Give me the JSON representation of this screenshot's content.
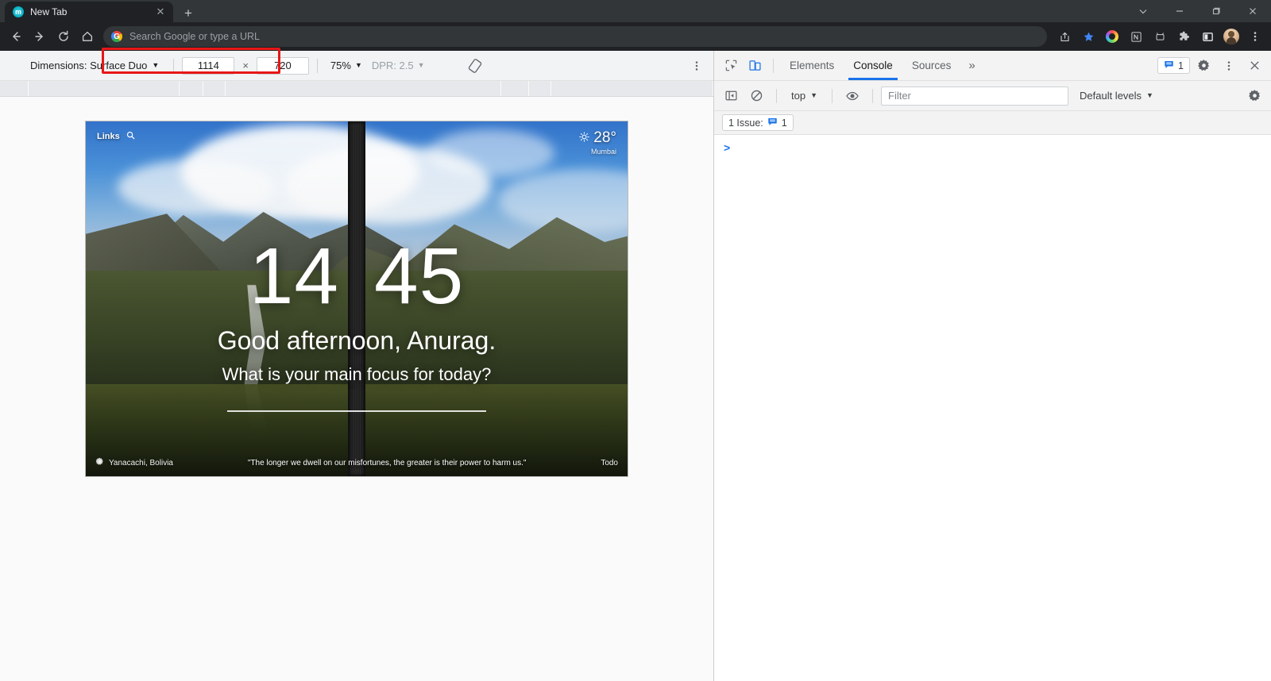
{
  "browser": {
    "tab": {
      "title": "New Tab",
      "favicon_icon": "circle-m-icon",
      "close_icon": "close-icon"
    },
    "new_tab_button_label": "+",
    "nav": {
      "back_icon": "back-arrow-icon",
      "forward_icon": "forward-arrow-icon",
      "reload_icon": "reload-icon",
      "home_icon": "home-icon"
    },
    "omnibox": {
      "placeholder": "Search Google or type a URL",
      "value": "",
      "search_engine_icon": "google-g-icon"
    },
    "toolbar_icons": [
      "share-icon",
      "bookmark-star-icon",
      "extension-color-icon",
      "notion-icon",
      "extension-small-icon",
      "puzzle-extensions-icon",
      "side-panel-icon",
      "profile-avatar-icon",
      "chrome-menu-icon"
    ],
    "window_controls": {
      "tab_search_icon": "chevron-down-icon",
      "minimize_icon": "minimize-icon",
      "maximize_icon": "maximize-icon",
      "close_icon": "window-close-icon"
    }
  },
  "device_toolbar": {
    "dimensions_label": "Dimensions: Surface Duo",
    "width": "1114",
    "times": "×",
    "height": "720",
    "zoom": "75%",
    "dpr": "DPR: 2.5",
    "rotate_icon": "rotate-device-icon",
    "kebab_icon": "more-options-icon",
    "highlight_color": "#e81717"
  },
  "new_tab_page": {
    "links_label": "Links",
    "search_icon": "search-icon",
    "weather": {
      "icon": "sun-icon",
      "temperature": "28°",
      "city": "Mumbai"
    },
    "clock": {
      "hours": "14",
      "minutes": "45"
    },
    "greeting": "Good afternoon, Anurag.",
    "focus_prompt": "What is your main focus for today?",
    "footer": {
      "settings_icon": "gear-icon",
      "photo_location": "Yanacachi, Bolivia",
      "quote": "\"The longer we dwell on our misfortunes, the greater is their power to harm us.\"",
      "todo_label": "Todo"
    }
  },
  "devtools": {
    "inspect_icon": "inspect-element-icon",
    "device_toggle_icon": "device-toolbar-icon",
    "tabs": [
      {
        "label": "Elements",
        "selected": false
      },
      {
        "label": "Console",
        "selected": true
      },
      {
        "label": "Sources",
        "selected": false
      }
    ],
    "more_tabs_label": "»",
    "issue_count_badge": "1",
    "issue_badge_icon": "issue-icon",
    "settings_icon": "gear-icon",
    "kebab_icon": "more-options-icon",
    "close_icon": "close-icon",
    "console": {
      "sidebar_toggle_icon": "console-sidebar-icon",
      "clear_icon": "clear-console-icon",
      "context": "top",
      "eye_icon": "live-expression-icon",
      "filter_placeholder": "Filter",
      "filter_value": "",
      "levels": "Default levels",
      "settings_icon": "console-settings-icon",
      "issues_text": "1 Issue:",
      "issues_count": "1",
      "prompt_symbol": ">"
    }
  }
}
